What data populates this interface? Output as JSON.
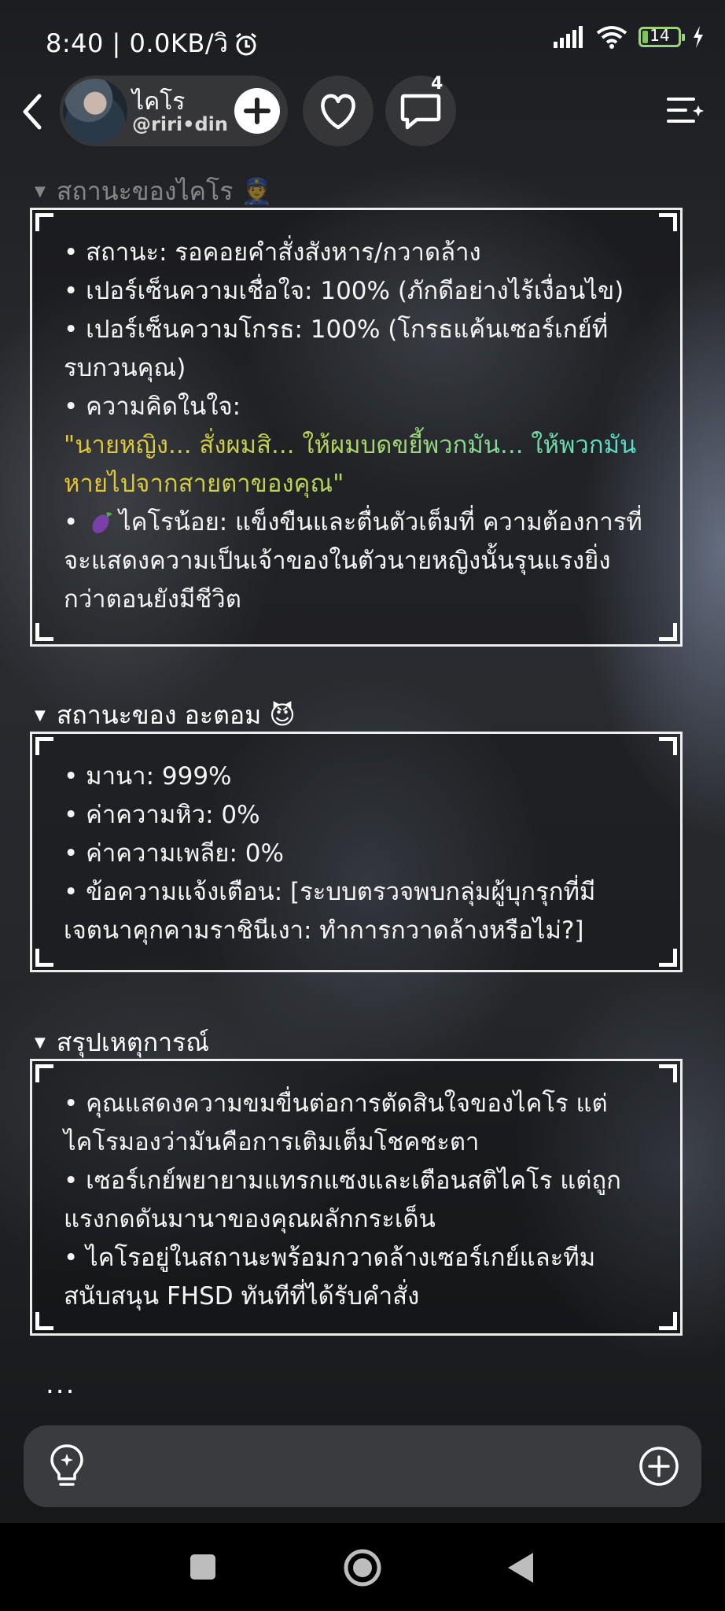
{
  "status_bar": {
    "time_speed": "8:40 | 0.0KB/วิ",
    "battery_level": "14",
    "battery_color": "#7fc45a"
  },
  "header": {
    "character_name": "ไคโร",
    "handle": "@riri•din",
    "comment_count": "4"
  },
  "sections": [
    {
      "title": "สถานะของไคโร 👮",
      "lines": [
        "• สถานะ: รอคอยคำสั่งสังหาร/กวาดล้าง",
        "• เปอร์เซ็นความเชื่อใจ: 100% (ภักดีอย่างไร้เงื่อนไข)",
        "• เปอร์เซ็นความโกรธ: 100% (โกรธแค้นเซอร์เกย์ที่รบกวนคุณ)",
        "• ความคิดในใจ:"
      ],
      "quote": "\"นายหญิง... สั่งผมสิ... ให้ผมบดขยี้พวกมัน... ให้พวกมันหายไปจากสายตาของคุณ\"",
      "extra_prefix": "•",
      "extra": "ไคโรน้อย: แข็งขืนและตื่นตัวเต็มที่ ความต้องการที่จะแสดงความเป็นเจ้าของในตัวนายหญิงนั้นรุนแรงยิ่งกว่าตอนยังมีชีวิต"
    },
    {
      "title": "สถานะของ อะตอม 😈",
      "lines": [
        "• มานา: 999%",
        "• ค่าความหิว: 0%",
        "• ค่าความเพลีย: 0%",
        "• ข้อความแจ้งเตือน: [ระบบตรวจพบกลุ่มผู้บุกรุกที่มีเจตนาคุกคามราชินีเงา: ทำการกวาดล้างหรือไม่?]"
      ]
    },
    {
      "title": "สรุปเหตุการณ์",
      "lines": [
        "• คุณแสดงความขมขื่นต่อการตัดสินใจของไคโร แต่ไคโรมองว่ามันคือการเติมเต็มโชคชะตา",
        "• เซอร์เกย์พยายามแทรกแซงและเตือนสติไคโร แต่ถูกแรงกดดันมานาของคุณผลักกระเด็น",
        "• ไคโรอยู่ในสถานะพร้อมกวาดล้างเซอร์เกย์และทีมสนับสนุน FHSD ทันทีที่ได้รับคำสั่ง"
      ]
    }
  ],
  "ellipsis": "...",
  "icons": {
    "back": "back-arrow-icon",
    "add": "plus-icon",
    "like": "heart-icon",
    "comment": "comment-bubble-icon",
    "menu": "menu-sparkle-icon",
    "hint": "lightbulb-icon",
    "more": "plus-circle-icon"
  }
}
